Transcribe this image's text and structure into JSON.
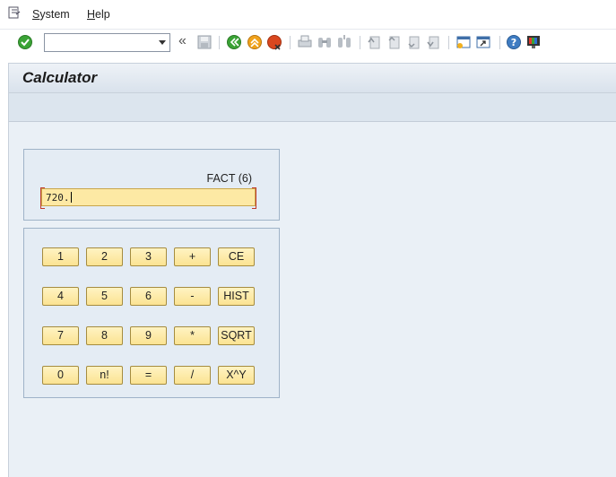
{
  "menu": {
    "items": [
      {
        "label": "System",
        "underline": "S",
        "rest": "ystem"
      },
      {
        "label": "Help",
        "underline": "H",
        "rest": "elp"
      }
    ]
  },
  "toolbar": {
    "command_field": {
      "value": "",
      "placeholder": ""
    },
    "icons": [
      "enter-icon",
      "command-dropdown-icon",
      "collapse-icon",
      "save-icon",
      "back-icon",
      "exit-icon",
      "cancel-icon",
      "print-icon",
      "find-icon",
      "find-next-icon",
      "first-page-icon",
      "previous-page-icon",
      "next-page-icon",
      "last-page-icon",
      "new-session-icon",
      "shortcut-icon",
      "help-icon",
      "customize-layout-icon"
    ]
  },
  "title": "Calculator",
  "display": {
    "expression": "FACT (6)",
    "result": "720."
  },
  "keypad": {
    "rows": [
      [
        "1",
        "2",
        "3",
        "+",
        "CE"
      ],
      [
        "4",
        "5",
        "6",
        "-",
        "HIST"
      ],
      [
        "7",
        "8",
        "9",
        "*",
        "SQRT"
      ],
      [
        "0",
        "n!",
        "=",
        "/",
        "X^Y"
      ]
    ]
  },
  "colors": {
    "key_fill": "#fbe392",
    "field_fill": "#fde9a4",
    "frame_border": "#9fb3c8",
    "content_bg": "#eaf0f6"
  }
}
